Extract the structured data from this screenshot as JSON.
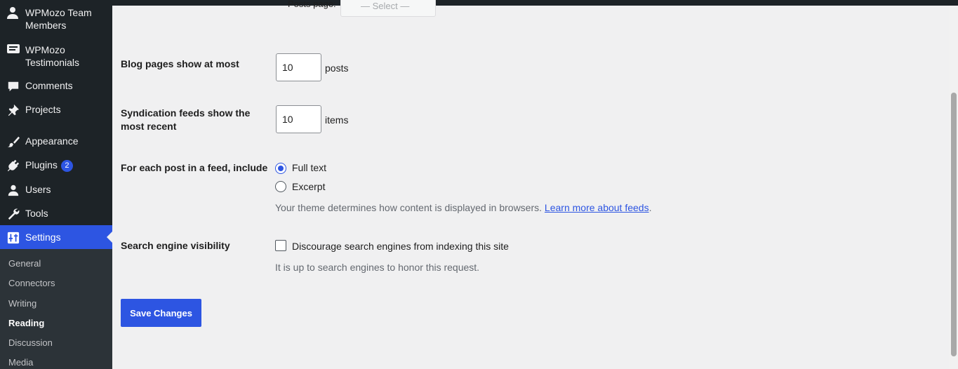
{
  "sidebar": {
    "items": [
      {
        "label": "WPMozo Team Members",
        "icon": "team-members-icon"
      },
      {
        "label": "WPMozo Testimonials",
        "icon": "testimonials-icon"
      },
      {
        "label": "Comments",
        "icon": "comment-icon"
      },
      {
        "label": "Projects",
        "icon": "pin-icon"
      },
      {
        "label": "Appearance",
        "icon": "paintbrush-icon"
      },
      {
        "label": "Plugins",
        "icon": "plugin-icon",
        "badge": "2"
      },
      {
        "label": "Users",
        "icon": "user-icon"
      },
      {
        "label": "Tools",
        "icon": "wrench-icon"
      },
      {
        "label": "Settings",
        "icon": "settings-icon"
      }
    ],
    "submenu": [
      "General",
      "Connectors",
      "Writing",
      "Reading",
      "Discussion",
      "Media"
    ],
    "current_submenu": "Reading"
  },
  "partial_top": {
    "posts_page_label": "Posts page:",
    "select_value": "— Select —"
  },
  "form": {
    "blog_pages": {
      "label": "Blog pages show at most",
      "value": "10",
      "unit": "posts"
    },
    "syndication": {
      "label": "Syndication feeds show the most recent",
      "label_line1": "Syndication feeds show the",
      "label_line2": "most recent",
      "value": "10",
      "unit": "items"
    },
    "feed_include": {
      "label": "For each post in a feed, include",
      "options": [
        "Full text",
        "Excerpt"
      ],
      "selected": "Full text",
      "description": "Your theme determines how content is displayed in browsers.",
      "link_text": "Learn more about feeds",
      "trailing": "."
    },
    "search_visibility": {
      "label": "Search engine visibility",
      "checkbox_label": "Discourage search engines from indexing this site",
      "checked": false,
      "description": "It is up to search engines to honor this request."
    },
    "save_label": "Save Changes"
  },
  "colors": {
    "accent": "#2d55e2",
    "sidebar": "#1d2327",
    "submenu": "#2c3338",
    "background": "#f0f0f1"
  }
}
